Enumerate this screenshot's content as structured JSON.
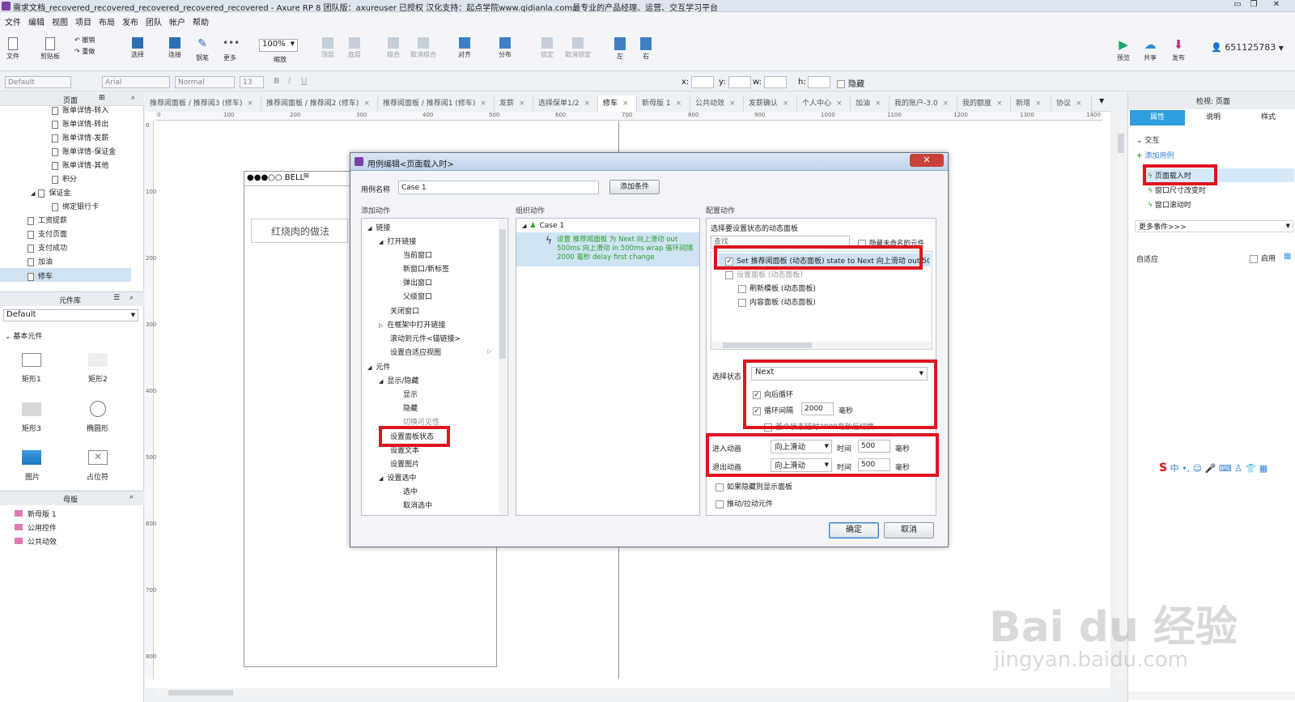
{
  "window": {
    "title": "需求文档_recovered_recovered_recovered_recovered_recovered - Axure RP 8 团队版：axureuser 已授权 汉化支持：起点学院www.qidianla.com最专业的产品经理、运营、交互学习平台"
  },
  "menu": [
    "文件",
    "编辑",
    "视图",
    "项目",
    "布局",
    "发布",
    "团队",
    "帐户",
    "帮助"
  ],
  "toolbar": {
    "file": "文件",
    "clipboard": "剪贴板",
    "undo": "撤销",
    "redo": "重做",
    "select": "选择",
    "connect": "连接",
    "pen": "钢笔",
    "more": "更多",
    "zoom": "100%",
    "zoom_label": "缩放",
    "top": "顶层",
    "bottom": "底层",
    "group": "组合",
    "ungroup": "取消组合",
    "align": "对齐",
    "distribute": "分布",
    "lock": "锁定",
    "unlock": "取消锁定",
    "left": "左",
    "right": "右",
    "preview": "预览",
    "share": "共享",
    "publish": "发布",
    "user": "651125783"
  },
  "format": {
    "style": "Default",
    "font": "Arial",
    "weight": "Normal",
    "size": "13",
    "x": "x:",
    "y": "y:",
    "w": "w:",
    "h": "h:",
    "hidden": "隐藏"
  },
  "pages": {
    "title": "页面",
    "items": [
      "账单详情-转入",
      "账单详情-转出",
      "账单详情-发薪",
      "账单详情-保证金",
      "账单详情-其他",
      "积分",
      "保证金",
      "绑定银行卡",
      "工资提薪",
      "支付页面",
      "支付成功",
      "加油",
      "修车"
    ]
  },
  "library": {
    "title": "元件库",
    "select": "Default",
    "group": "基本元件",
    "items": [
      "矩形1",
      "矩形2",
      "矩形3",
      "椭圆形",
      "图片",
      "占位符"
    ]
  },
  "masters": {
    "title": "母版",
    "items": [
      "新母版 1",
      "公用控件",
      "公共动效"
    ]
  },
  "tabs": [
    "推荐阅面板 / 推荐阅3 (修车)",
    "推荐阅面板 / 推荐阅2 (修车)",
    "推荐阅面板 / 推荐阅1 (修车)",
    "发薪",
    "选择保单1/2",
    "修车",
    "新母版 1",
    "公共动效",
    "发薪确认",
    "个人中心",
    "加油",
    "我的账户-3.0",
    "我的额度",
    "新增",
    "协议"
  ],
  "ruler": [
    "0",
    "100",
    "200",
    "300",
    "400",
    "500",
    "600",
    "700",
    "800",
    "900",
    "1000",
    "1100",
    "1200",
    "1300",
    "1400"
  ],
  "vruler": [
    "0",
    "100",
    "200",
    "300",
    "400",
    "500",
    "600",
    "700",
    "800"
  ],
  "canvas": {
    "status": "●●●○○ BELL",
    "card": "红烧肉的做法"
  },
  "dialog": {
    "title": "用例编辑<页面载入时>",
    "case_name_label": "用例名称",
    "case_name": "Case 1",
    "add_condition": "添加条件",
    "col_add": "添加动作",
    "col_org": "组织动作",
    "col_cfg": "配置动作",
    "actions": [
      "链接",
      "打开链接",
      "当前窗口",
      "新窗口/新标签",
      "弹出窗口",
      "父级窗口",
      "关闭窗口",
      "在框架中打开链接",
      "滚动到元件<锚链接>",
      "设置自适应视图",
      "元件",
      "显示/隐藏",
      "显示",
      "隐藏",
      "切换可见性",
      "设置面板状态",
      "设置文本",
      "设置图片",
      "设置选中",
      "选中",
      "取消选中"
    ],
    "org_case": "Case 1",
    "org_action": "设置 推荐阅面板 为 Next 向上滑动 out 500ms 向上滑动 in 500ms wrap 循环间隔 2000 毫秒 delay first change",
    "cfg_title": "选择要设置状态的动态面板",
    "cfg_search": "查找",
    "cfg_hide_unnamed": "隐藏未命名的元件",
    "cfg_items": [
      "Set 推荐阅面板 (动态面板) state to Next 向上滑动 out 500m",
      "设置面板 (动态面板)",
      "刷新模板 (动态面板)",
      "内容面板 (动态面板)"
    ],
    "state_label": "选择状态",
    "state_value": "Next",
    "wrap": "向后循环",
    "loop": "循环间隔",
    "loop_ms": "2000",
    "ms": "毫秒",
    "first": "首个状态延时2000毫秒后切换",
    "enter_anim": "进入动画",
    "exit_anim": "退出动画",
    "anim": "向上滑动",
    "time": "时间",
    "time_ms": "500",
    "show_if_hidden": "如果隐藏则显示面板",
    "push": "推动/拉动元件",
    "ok": "确定",
    "cancel": "取消"
  },
  "inspector": {
    "title": "检视: 页面",
    "tabs": [
      "属性",
      "说明",
      "样式"
    ],
    "section": "交互",
    "add_case": "添加用例",
    "events": [
      "页面载入时",
      "窗口尺寸改变时",
      "窗口滚动时"
    ],
    "more": "更多事件>>>",
    "adaptive": "自适应",
    "enable": "启用"
  },
  "ime": "中",
  "watermark": {
    "logo": "Bai du 经验",
    "url": "jingyan.baidu.com"
  },
  "colors": {
    "accent": "#2f9ee0",
    "highlight": "#e0141f",
    "green": "#2aa02a"
  }
}
